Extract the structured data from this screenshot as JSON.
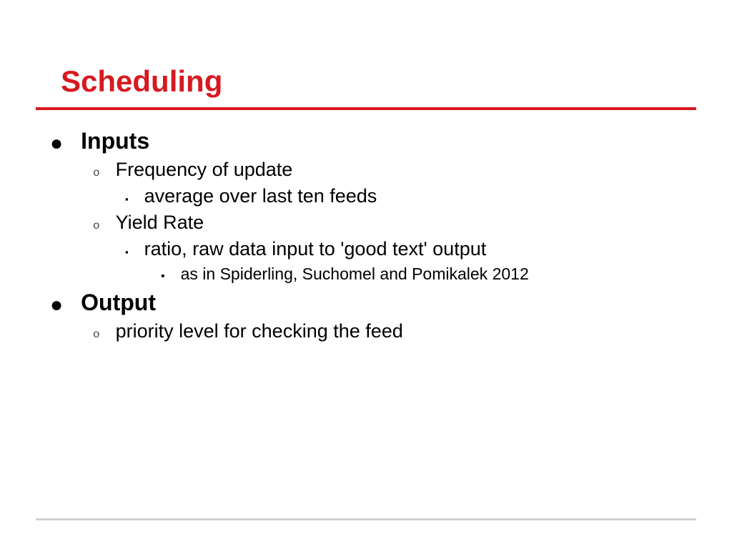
{
  "title": "Scheduling",
  "sections": [
    {
      "heading": "Inputs",
      "items": [
        {
          "text": "Frequency of update",
          "sub": [
            {
              "text": "average over last ten feeds",
              "sub": []
            }
          ]
        },
        {
          "text": "Yield Rate",
          "sub": [
            {
              "text": "ratio, raw data input to 'good text' output",
              "sub": [
                {
                  "text": "as in Spiderling, Suchomel and Pomikalek 2012"
                }
              ]
            }
          ]
        }
      ]
    },
    {
      "heading": "Output",
      "items": [
        {
          "text": "priority level for checking the feed",
          "sub": []
        }
      ]
    }
  ]
}
